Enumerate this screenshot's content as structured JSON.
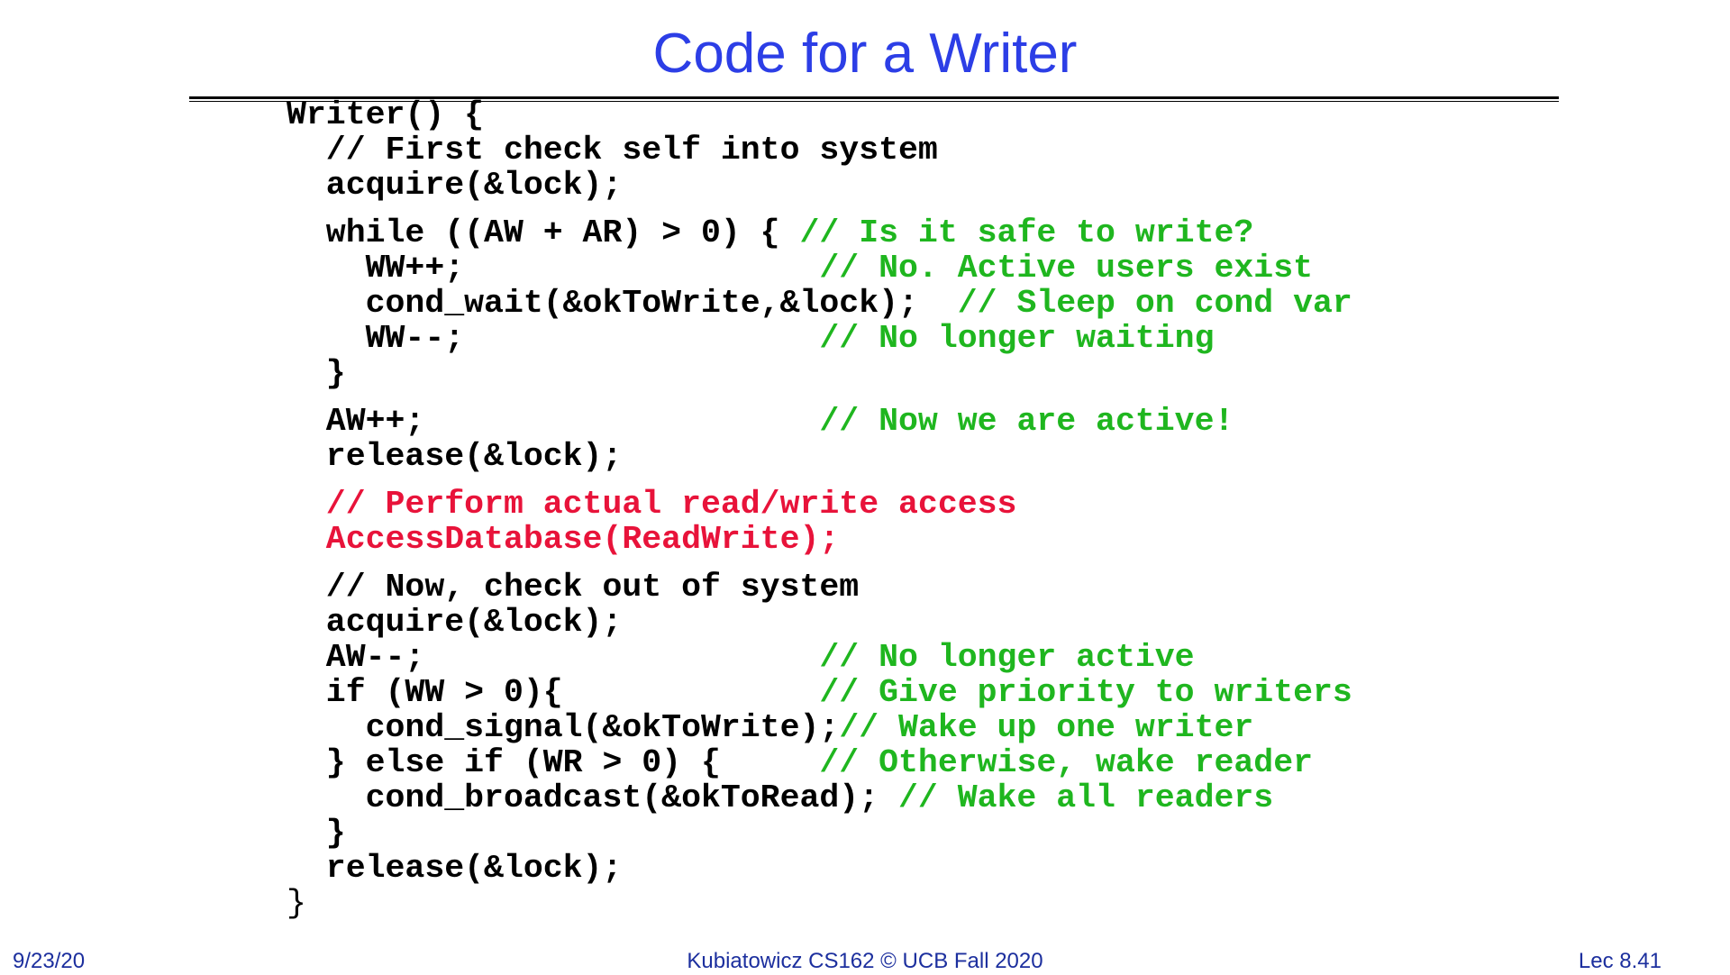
{
  "slide": {
    "title": "Code for a Writer",
    "code": [
      {
        "code": "Writer() {",
        "comment": ""
      },
      {
        "code": "  // First check self into system",
        "comment": ""
      },
      {
        "code": "  acquire(&lock);",
        "comment": ""
      },
      {
        "code": "  while ((AW + AR) > 0) { ",
        "comment": "// Is it safe to write?"
      },
      {
        "code": "    WW++;                  ",
        "comment": "// No. Active users exist"
      },
      {
        "code": "    cond_wait(&okToWrite,&lock);  ",
        "comment": "// Sleep on cond var"
      },
      {
        "code": "    WW--;                  ",
        "comment": "// No longer waiting"
      },
      {
        "code": "  }",
        "comment": ""
      },
      {
        "code": "  AW++;                    ",
        "comment": "// Now we are active!"
      },
      {
        "code": "  release(&lock);",
        "comment": ""
      },
      {
        "code": "  // Perform actual read/write access",
        "comment": ""
      },
      {
        "code": "  AccessDatabase(ReadWrite);",
        "comment": ""
      },
      {
        "code": "  // Now, check out of system",
        "comment": ""
      },
      {
        "code": "  acquire(&lock);",
        "comment": ""
      },
      {
        "code": "  AW--;                    ",
        "comment": "// No longer active"
      },
      {
        "code": "  if (WW > 0){             ",
        "comment": "// Give priority to writers"
      },
      {
        "code": "    cond_signal(&okToWrite);",
        "comment": "// Wake up one writer"
      },
      {
        "code": "  } else if (WR > 0) {     ",
        "comment": "// Otherwise, wake reader"
      },
      {
        "code": "    cond_broadcast(&okToRead); ",
        "comment": "// Wake all readers"
      },
      {
        "code": "  }",
        "comment": ""
      },
      {
        "code": "  release(&lock);",
        "comment": ""
      },
      {
        "code": "}",
        "comment": ""
      }
    ],
    "colors": {
      "title": "#2c3ee6",
      "code": "#000000",
      "comment": "#1fb61f",
      "highlight": "#e8133a",
      "footer": "#1c2f9e"
    },
    "footer": {
      "date": "9/23/20",
      "course": "Kubiatowicz CS162 © UCB Fall 2020",
      "lecture": "Lec 8.41"
    }
  }
}
